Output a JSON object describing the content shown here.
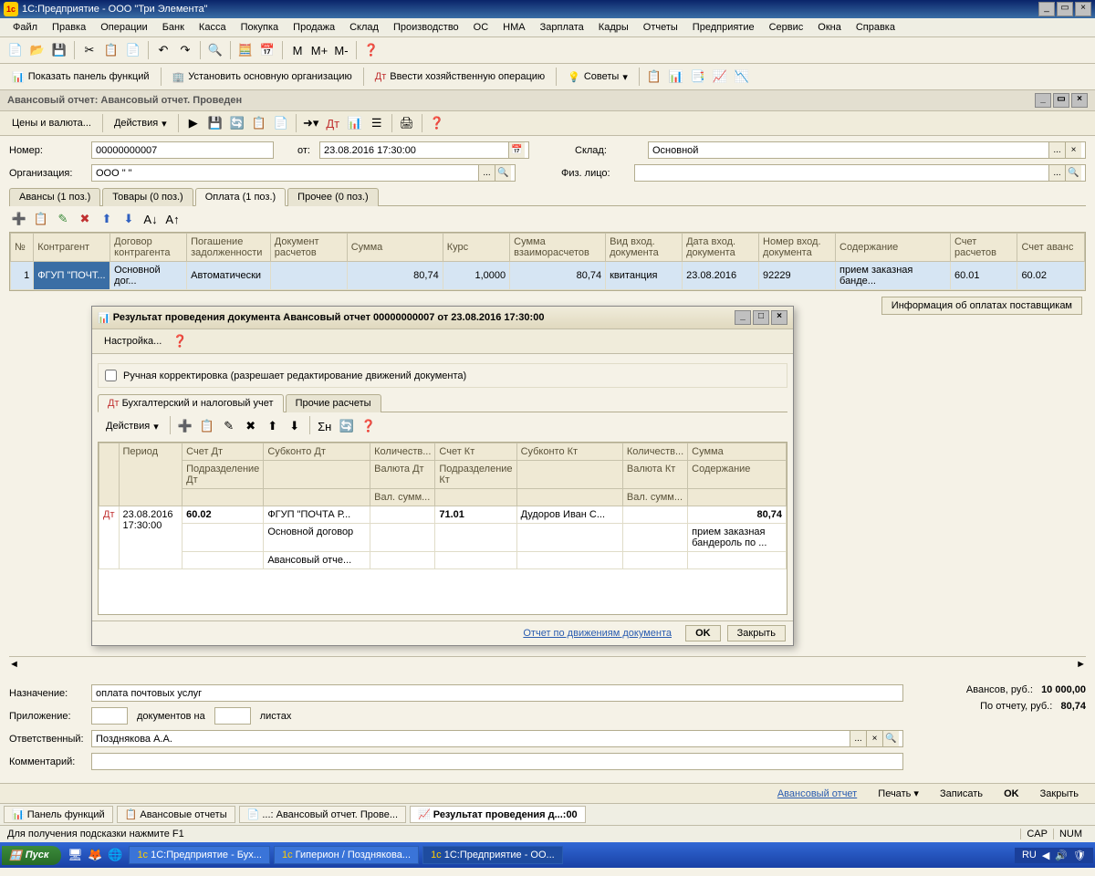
{
  "app": {
    "title": "1С:Предприятие - ООО \"Три Элемента\""
  },
  "menu": [
    "Файл",
    "Правка",
    "Операции",
    "Банк",
    "Касса",
    "Покупка",
    "Продажа",
    "Склад",
    "Производство",
    "ОС",
    "НМА",
    "Зарплата",
    "Кадры",
    "Отчеты",
    "Предприятие",
    "Сервис",
    "Окна",
    "Справка"
  ],
  "toolbar2": {
    "show_panel": "Показать панель функций",
    "set_org": "Установить основную организацию",
    "enter_op": "Ввести хозяйственную операцию",
    "advice": "Советы"
  },
  "doc": {
    "title": "Авансовый отчет: Авансовый отчет. Проведен",
    "prices": "Цены и валюта...",
    "actions": "Действия",
    "number_label": "Номер:",
    "number": "00000000007",
    "from_label": "от:",
    "from": "23.08.2016 17:30:00",
    "warehouse_label": "Склад:",
    "warehouse": "Основной",
    "org_label": "Организация:",
    "org": "ООО \"             \"",
    "person_label": "Физ. лицо:",
    "person": "",
    "tabs": [
      "Авансы (1 поз.)",
      "Товары (0 поз.)",
      "Оплата (1 поз.)",
      "Прочее (0 поз.)"
    ],
    "active_tab": 2,
    "grid_headers": [
      "№",
      "Контрагент",
      "Договор контрагента",
      "Погашение задолженности",
      "Документ расчетов",
      "Сумма",
      "Курс",
      "Сумма взаиморасчетов",
      "Вид вход. документа",
      "Дата вход. документа",
      "Номер вход. документа",
      "Содержание",
      "Счет расчетов",
      "Счет аванс"
    ],
    "grid_row": {
      "n": "1",
      "contr": "ФГУП \"ПОЧТ...",
      "dog": "Основной дог...",
      "pog": "Автоматически",
      "docr": "",
      "sum": "80,74",
      "kurs": "1,0000",
      "sumv": "80,74",
      "vid": "квитанция",
      "date": "23.08.2016",
      "num": "92229",
      "cont": "прием заказная банде...",
      "sr": "60.01",
      "sa": "60.02"
    },
    "info_btn": "Информация об оплатах поставщикам",
    "purpose_label": "Назначение:",
    "purpose": "оплата почтовых услуг",
    "attach_label": "Приложение:",
    "attach_docs": "документов на",
    "attach_sheets": "листах",
    "resp_label": "Ответственный:",
    "resp": "Позднякова А.А.",
    "comment_label": "Комментарий:",
    "comment": "",
    "avans_label": "Авансов, руб.:",
    "avans_val": "10 000,00",
    "report_label": "По отчету, руб.:",
    "report_val": "80,74",
    "footer": {
      "link": "Авансовый отчет",
      "print": "Печать",
      "save": "Записать",
      "ok": "OK",
      "close": "Закрыть"
    }
  },
  "modal": {
    "title": "Результат проведения документа Авансовый отчет 00000000007 от 23.08.2016 17:30:00",
    "settings": "Настройка...",
    "manual_label": "Ручная корректировка (разрешает редактирование движений документа)",
    "tabs": [
      "Бухгалтерский и налоговый учет",
      "Прочие расчеты"
    ],
    "actions": "Действия",
    "headers": {
      "period": "Период",
      "acc_dt": "Счет Дт",
      "sub_dt": "Субконто Дт",
      "qty1": "Количеств...",
      "acc_kt": "Счет Кт",
      "sub_kt": "Субконто Кт",
      "qty2": "Количеств...",
      "sum": "Сумма",
      "div_dt": "Подразделение Дт",
      "cur_dt": "Валюта Дт",
      "div_kt": "Подразделение Кт",
      "cur_kt": "Валюта Кт",
      "cont": "Содержание",
      "vals_dt": "Вал. сумм...",
      "vals_kt": "Вал. сумм..."
    },
    "row": {
      "date": "23.08.2016 17:30:00",
      "acc_dt": "60.02",
      "sub_dt1": "ФГУП \"ПОЧТА Р...",
      "sub_dt2": "Основной договор",
      "sub_dt3": "Авансовый отче...",
      "acc_kt": "71.01",
      "sub_kt": "Дудоров  Иван С...",
      "sum": "80,74",
      "cont": "прием заказная бандероль по ..."
    },
    "footer": {
      "report": "Отчет по движениям документа",
      "ok": "OK",
      "close": "Закрыть"
    }
  },
  "mdi": [
    "Панель функций",
    "Авансовые отчеты",
    "...: Авансовый отчет. Прове...",
    "Результат проведения д...:00"
  ],
  "status": {
    "hint": "Для получения подсказки нажмите F1",
    "cap": "CAP",
    "num": "NUM"
  },
  "taskbar": {
    "start": "Пуск",
    "items": [
      "1С:Предприятие - Бух...",
      "Гиперион / Позднякова...",
      "1С:Предприятие - ОО..."
    ],
    "lang": "RU"
  }
}
